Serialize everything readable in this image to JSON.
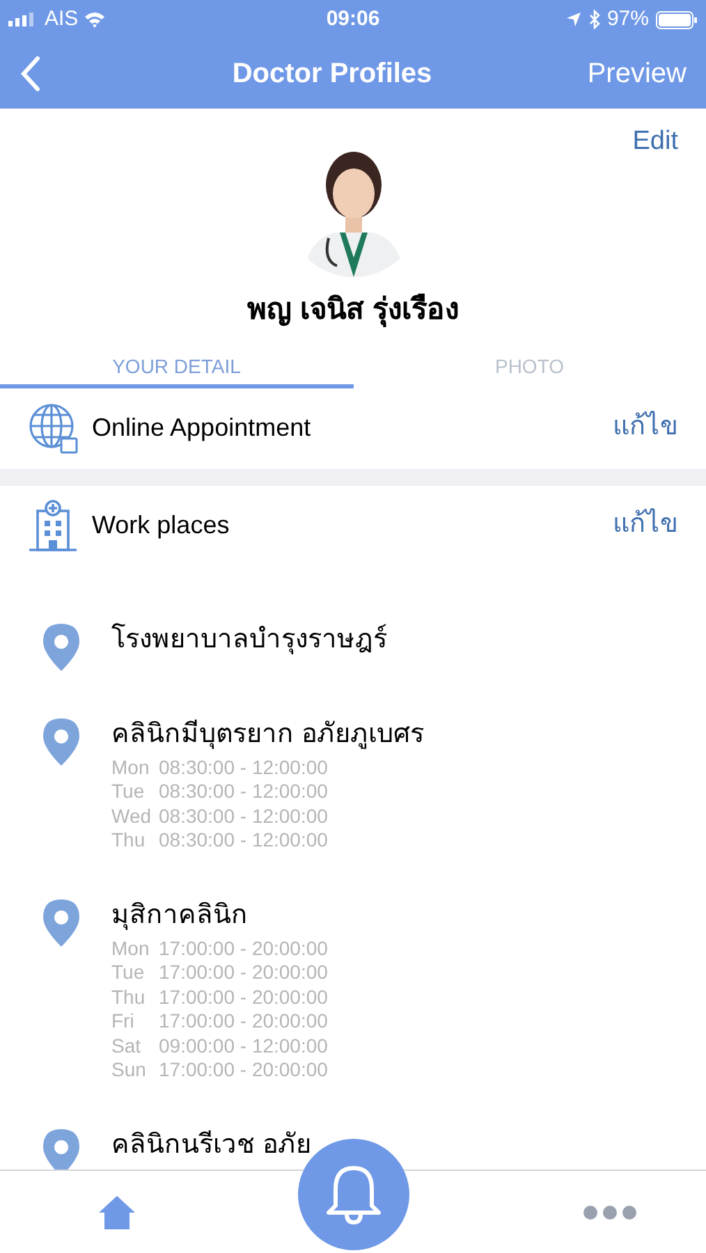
{
  "status_bar": {
    "carrier": "AIS",
    "time": "09:06",
    "battery": "97%"
  },
  "nav_bar": {
    "title": "Doctor Profiles",
    "action": "Preview"
  },
  "profile": {
    "edit": "Edit",
    "name": "พญ เจนิส รุ่งเรือง"
  },
  "tabs": [
    {
      "label": "YOUR DETAIL",
      "selected": true
    },
    {
      "label": "PHOTO",
      "selected": false
    }
  ],
  "sections": [
    {
      "kind": "globe",
      "title": "Online Appointment",
      "action": "แก้ไข"
    },
    {
      "kind": "building",
      "title": "Work places",
      "action": "แก้ไข"
    }
  ],
  "work_places": [
    {
      "name": "โรงพยาบาลบำรุงราษฎร์"
    },
    {
      "name": "คลินิกมีบุตรยาก อภัยภูเบศร",
      "schedule": [
        {
          "day": "Mon",
          "time": "08:30:00 - 12:00:00"
        },
        {
          "day": "Tue",
          "time": "08:30:00 - 12:00:00"
        },
        {
          "day": "Wed",
          "time": "08:30:00 - 12:00:00"
        },
        {
          "day": "Thu",
          "time": "08:30:00 - 12:00:00"
        }
      ]
    },
    {
      "name": "มุสิกาคลินิก",
      "schedule": [
        {
          "day": "Mon",
          "time": "17:00:00 - 20:00:00"
        },
        {
          "day": "Tue",
          "time": "17:00:00 - 20:00:00"
        },
        {
          "day": "Thu",
          "time": "17:00:00 - 20:00:00"
        },
        {
          "day": "Fri",
          "time": "17:00:00 - 20:00:00"
        },
        {
          "day": "Sat",
          "time": "09:00:00 - 12:00:00"
        },
        {
          "day": "Sun",
          "time": "17:00:00 - 20:00:00"
        }
      ]
    },
    {
      "name": "คลินิกนรีเวช อภัย"
    }
  ]
}
